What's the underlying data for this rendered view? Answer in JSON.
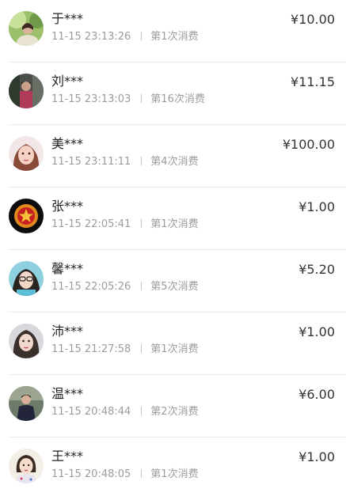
{
  "currency_symbol": "¥",
  "transactions": [
    {
      "name": "于***",
      "time": "11-15 23:13:26",
      "count_label": "第1次消费",
      "amount": "¥10.00",
      "avatar": "avatar-photo-1"
    },
    {
      "name": "刘***",
      "time": "11-15 23:13:03",
      "count_label": "第16次消费",
      "amount": "¥11.15",
      "avatar": "avatar-photo-2"
    },
    {
      "name": "美***",
      "time": "11-15 23:11:11",
      "count_label": "第4次消费",
      "amount": "¥100.00",
      "avatar": "avatar-photo-3"
    },
    {
      "name": "张***",
      "time": "11-15 22:05:41",
      "count_label": "第1次消费",
      "amount": "¥1.00",
      "avatar": "avatar-emblem"
    },
    {
      "name": "馨***",
      "time": "11-15 22:05:26",
      "count_label": "第5次消费",
      "amount": "¥5.20",
      "avatar": "avatar-photo-5"
    },
    {
      "name": "沛***",
      "time": "11-15 21:27:58",
      "count_label": "第1次消费",
      "amount": "¥1.00",
      "avatar": "avatar-photo-6"
    },
    {
      "name": "温***",
      "time": "11-15 20:48:44",
      "count_label": "第2次消费",
      "amount": "¥6.00",
      "avatar": "avatar-photo-7"
    },
    {
      "name": "王***",
      "time": "11-15 20:48:05",
      "count_label": "第1次消费",
      "amount": "¥1.00",
      "avatar": "avatar-photo-8"
    }
  ],
  "colors": {
    "name_text": "#222222",
    "meta_text": "#9c9c9c",
    "amount_text": "#333333",
    "divider": "#ececec"
  }
}
